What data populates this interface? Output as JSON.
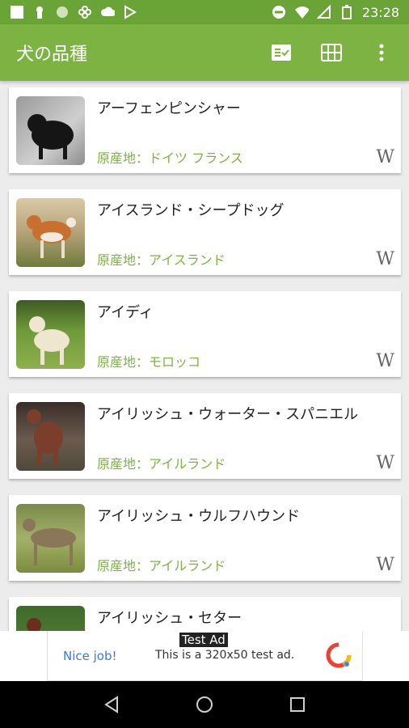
{
  "status_bar": {
    "time": "23:28",
    "left_icons": [
      "square-icon",
      "keyhole-icon",
      "circle-icon",
      "fan-icon",
      "cloud-icon",
      "play-store-icon"
    ],
    "right_icons": [
      "do-not-disturb-icon",
      "wifi-icon",
      "signal-icon",
      "battery-icon"
    ]
  },
  "app_bar": {
    "title": "犬の品種",
    "actions": [
      "checklist-icon",
      "grid-icon",
      "more-vert-icon"
    ]
  },
  "breeds": [
    {
      "name": "アーフェンピンシャー",
      "origin": "原産地：ドイツ フランス",
      "wiki": "W"
    },
    {
      "name": "アイスランド・シープドッグ",
      "origin": "原産地：アイスランド",
      "wiki": "W"
    },
    {
      "name": "アイディ",
      "origin": "原産地：モロッコ",
      "wiki": "W"
    },
    {
      "name": "アイリッシュ・ウォーター・スパニエル",
      "origin": "原産地：アイルランド",
      "wiki": "W"
    },
    {
      "name": "アイリッシュ・ウルフハウンド",
      "origin": "原産地：アイルランド",
      "wiki": "W"
    },
    {
      "name": "アイリッシュ・セター",
      "origin": "",
      "wiki": ""
    }
  ],
  "ad": {
    "label": "Test Ad",
    "nice": "Nice job!",
    "text": "This is a 320x50 test ad."
  },
  "nav": [
    "back-icon",
    "home-icon",
    "recents-icon"
  ]
}
